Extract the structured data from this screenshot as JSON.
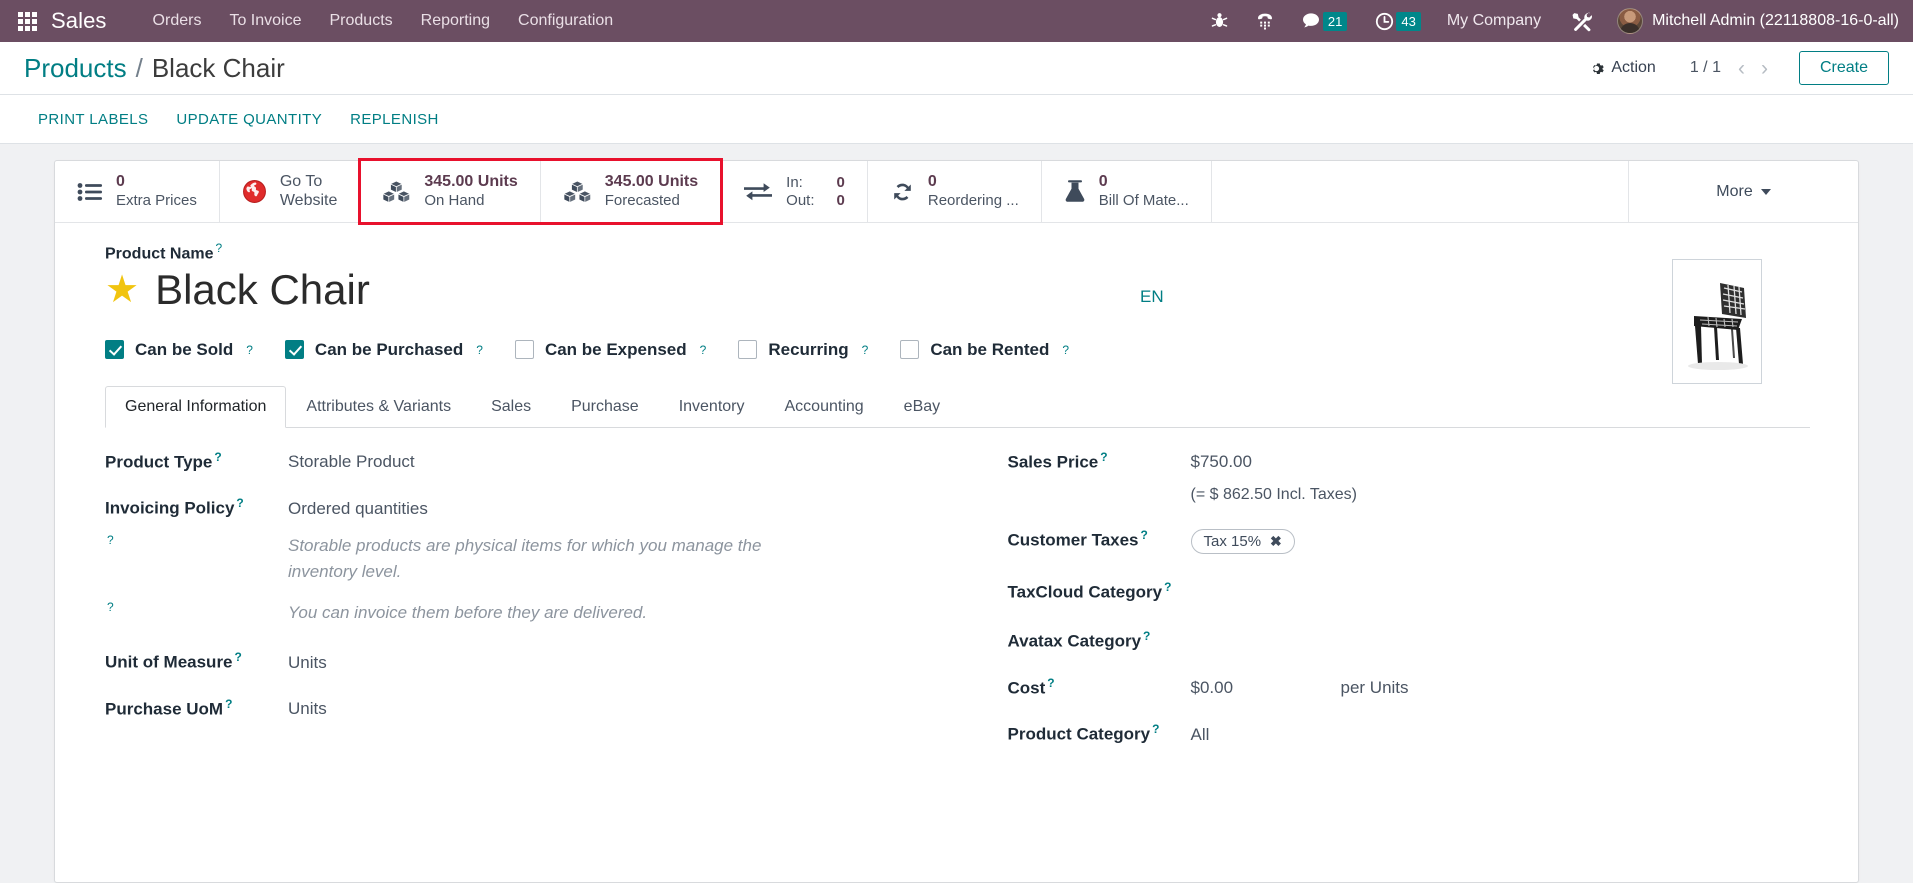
{
  "navbar": {
    "apps_icon": "apps-grid-icon",
    "brand": "Sales",
    "menu": [
      {
        "label": "Orders"
      },
      {
        "label": "To Invoice"
      },
      {
        "label": "Products"
      },
      {
        "label": "Reporting"
      },
      {
        "label": "Configuration"
      }
    ],
    "icons": [
      {
        "name": "bug-icon"
      },
      {
        "name": "dialpad-icon"
      },
      {
        "name": "messages-icon",
        "badge": "21"
      },
      {
        "name": "activities-clock-icon",
        "badge": "43"
      }
    ],
    "company": "My Company",
    "tools_icon": "wrench-screwdriver-icon",
    "user": "Mitchell Admin (22118808-16-0-all)"
  },
  "control_panel": {
    "breadcrumb_root": "Products",
    "breadcrumb_sep": "/",
    "breadcrumb_current": "Black Chair",
    "action_label": "Action",
    "pager": "1 / 1",
    "prev_arrow": "‹",
    "next_arrow": "›",
    "create_label": "Create"
  },
  "actions_bar": {
    "buttons": [
      {
        "label": "PRINT LABELS"
      },
      {
        "label": "UPDATE QUANTITY"
      },
      {
        "label": "REPLENISH"
      }
    ]
  },
  "stat_buttons": {
    "extra_prices": {
      "value": "0",
      "label": "Extra Prices",
      "icon": "list-ul-icon"
    },
    "go_to_website": {
      "line1": "Go To",
      "line2": "Website",
      "icon": "globe-icon"
    },
    "on_hand": {
      "value": "345.00 Units",
      "label": "On Hand",
      "icon": "cubes-icon"
    },
    "forecasted": {
      "value": "345.00 Units",
      "label": "Forecasted",
      "icon": "cubes-icon"
    },
    "in_out": {
      "in_key": "In:",
      "in_value": "0",
      "out_key": "Out:",
      "out_value": "0",
      "icon": "exchange-arrows-icon"
    },
    "reordering": {
      "value": "0",
      "label": "Reordering ...",
      "icon": "refresh-icon"
    },
    "bill_of_materials": {
      "value": "0",
      "label": "Bill Of Mate...",
      "icon": "flask-icon"
    },
    "more": {
      "label": "More",
      "icon": "chevron-down-icon"
    }
  },
  "product": {
    "name_label": "Product Name",
    "name": "Black Chair",
    "favorite_star": "★",
    "language_badge": "EN",
    "image_alt": "black-chair-photo"
  },
  "checkboxes": [
    {
      "label": "Can be Sold",
      "checked": true
    },
    {
      "label": "Can be Purchased",
      "checked": true
    },
    {
      "label": "Can be Expensed",
      "checked": false
    },
    {
      "label": "Recurring",
      "checked": false
    },
    {
      "label": "Can be Rented",
      "checked": false
    }
  ],
  "tabs": [
    {
      "label": "General Information",
      "active": true
    },
    {
      "label": "Attributes & Variants",
      "active": false
    },
    {
      "label": "Sales",
      "active": false
    },
    {
      "label": "Purchase",
      "active": false
    },
    {
      "label": "Inventory",
      "active": false
    },
    {
      "label": "Accounting",
      "active": false
    },
    {
      "label": "eBay",
      "active": false
    }
  ],
  "general_information": {
    "left": {
      "product_type_label": "Product Type",
      "product_type_value": "Storable Product",
      "invoicing_policy_label": "Invoicing Policy",
      "invoicing_policy_value": "Ordered quantities",
      "note_1": "Storable products are physical items for which you manage the inventory level.",
      "note_2": "You can invoice them before they are delivered.",
      "uom_label": "Unit of Measure",
      "uom_value": "Units",
      "purchase_uom_label": "Purchase UoM",
      "purchase_uom_value": "Units"
    },
    "right": {
      "sales_price_label": "Sales Price",
      "sales_price_value": "$750.00",
      "sales_price_incl_taxes": "(= $ 862.50 Incl. Taxes)",
      "customer_taxes_label": "Customer Taxes",
      "customer_taxes_tag": "Tax 15%",
      "customer_taxes_tag_remove": "✖",
      "taxcloud_category_label": "TaxCloud Category",
      "taxcloud_category_value": "",
      "avatax_category_label": "Avatax Category",
      "avatax_category_value": "",
      "cost_label": "Cost",
      "cost_value": "$0.00",
      "cost_per": "per Units",
      "product_category_label": "Product Category",
      "product_category_value": "All"
    }
  },
  "colors": {
    "navbar_bg": "#6b4e62",
    "accent_teal": "#017e84",
    "badge_teal": "#00878a",
    "highlight_red": "#e8112d",
    "star_yellow": "#f1c40f",
    "stat_value_purple": "#5c3b4f"
  }
}
